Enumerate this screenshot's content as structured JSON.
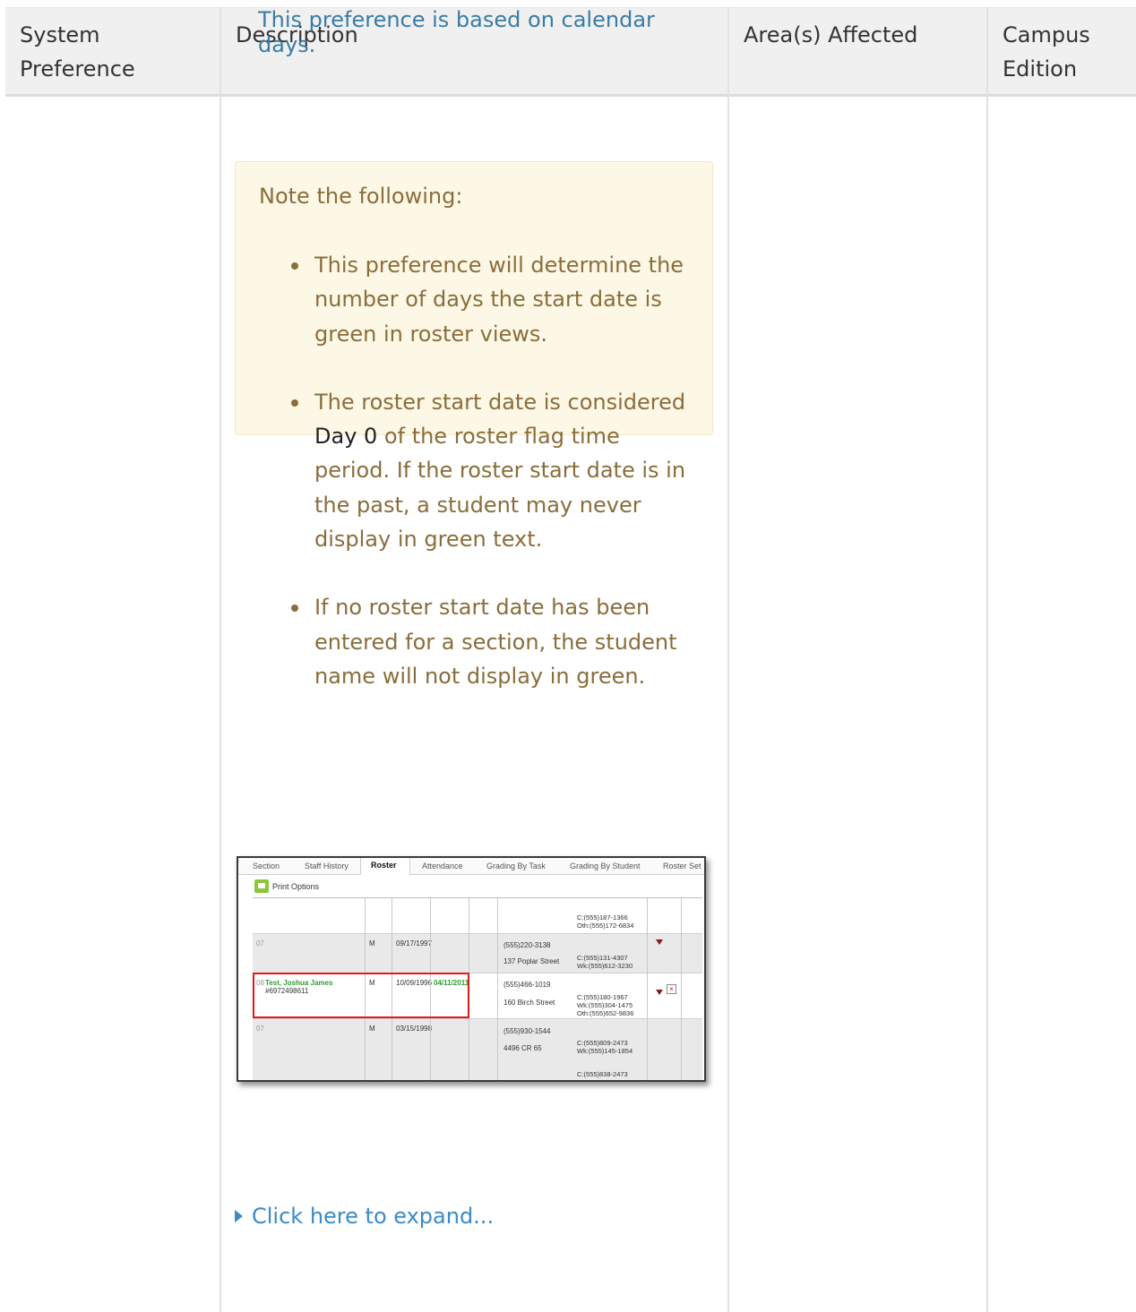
{
  "table": {
    "headers": [
      "System Preference",
      "Description",
      "Area(s) Affected",
      "Campus Edition"
    ],
    "header_overlay": "This preference is based on calendar days."
  },
  "note": {
    "title": "Note the following:",
    "bullets": [
      {
        "text": "This preference will determine the number of days the start date is green in roster views."
      },
      {
        "before": "The roster start date is considered ",
        "highlight": "Day 0",
        "after": " of the roster flag time period.  If the roster start date is in the past, a student may never display in green text."
      },
      {
        "text": "If no roster start date has been entered for a section, the student name will not display in green."
      }
    ]
  },
  "screenshot": {
    "tabs": [
      "Section",
      "Staff History",
      "Roster",
      "Attendance",
      "Grading By Task",
      "Grading By Student",
      "Roster Set"
    ],
    "active_tab": "Roster",
    "print_label": "Print Options",
    "rows": [
      {
        "num": "",
        "name": "",
        "id": "",
        "gender": "",
        "birth": "",
        "start": "",
        "phone": "",
        "address": "",
        "contacts": [
          "C:(555)187-1366",
          "Oth:(555)172-6834"
        ]
      },
      {
        "num": "07",
        "name": "",
        "id": "",
        "gender": "M",
        "birth": "09/17/1997",
        "start": "",
        "phone": "(555)220-3138",
        "address": "137 Poplar Street",
        "contacts": [
          "C:(555)131-4307",
          "Wk:(555)612-3230"
        ]
      },
      {
        "num": "08",
        "name": "Test, Joshua James",
        "id": "#6972498611",
        "gender": "M",
        "birth": "10/09/1996",
        "start": "04/11/2011",
        "phone": "(555)466-1019",
        "address": "160 Birch Street",
        "contacts": [
          "C:(555)180-1967",
          "Wk:(555)304-1475",
          "Oth:(555)652-9836"
        ]
      },
      {
        "num": "07",
        "name": "",
        "id": "",
        "gender": "M",
        "birth": "03/15/1998",
        "start": "",
        "phone": "(555)930-1544",
        "address": "4496 CR 65",
        "contacts": [
          "C:(555)809-2473",
          "Wk:(555)145-1854",
          "C:(555)838-2473"
        ]
      }
    ]
  },
  "expand_link": "Click here to expand...",
  "colors": {
    "note_bg": "#fdf8e6",
    "note_text": "#8a6d3b",
    "link": "#3a8bc8",
    "green_student": "#2e9e2e",
    "highlight_border": "#e01b1b"
  }
}
